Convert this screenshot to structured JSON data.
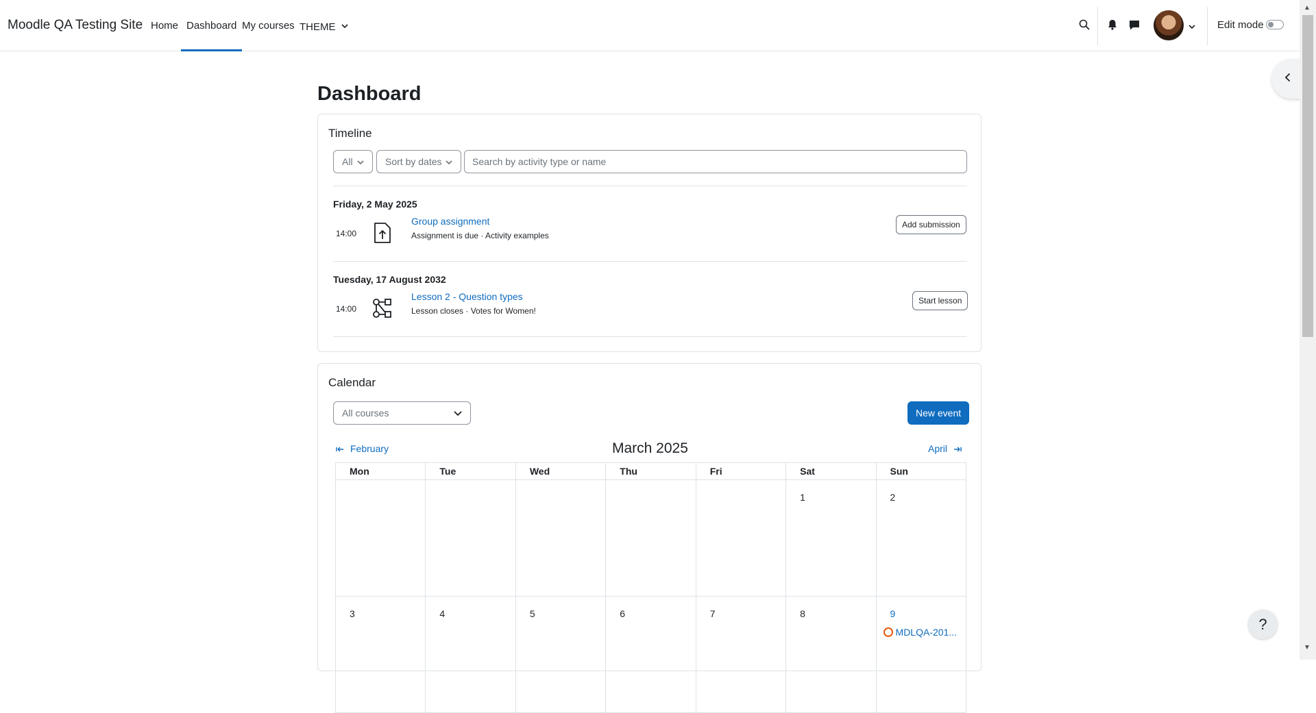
{
  "navbar": {
    "brand": "Moodle QA Testing Site",
    "items": [
      {
        "label": "Home"
      },
      {
        "label": "Dashboard"
      },
      {
        "label": "My courses"
      },
      {
        "label": "THEME"
      }
    ],
    "edit_mode_label": "Edit mode"
  },
  "page": {
    "title": "Dashboard"
  },
  "timeline": {
    "title": "Timeline",
    "filter_value": "All",
    "sort_value": "Sort by dates",
    "search_placeholder": "Search by activity type or name",
    "groups": [
      {
        "date": "Friday, 2 May 2025",
        "time": "14:00",
        "icon": "assignment-upload-icon",
        "name": "Group assignment",
        "subtitle": "Assignment is due · Activity examples",
        "action": "Add submission"
      },
      {
        "date": "Tuesday, 17 August 2032",
        "time": "14:00",
        "icon": "lesson-icon",
        "name": "Lesson 2 - Question types",
        "subtitle": "Lesson closes · Votes for Women!",
        "action": "Start lesson"
      }
    ]
  },
  "calendar": {
    "title": "Calendar",
    "course_filter": "All courses",
    "new_event_label": "New event",
    "prev_month": "February",
    "current_month": "March 2025",
    "next_month": "April",
    "weekdays": [
      "Mon",
      "Tue",
      "Wed",
      "Thu",
      "Fri",
      "Sat",
      "Sun"
    ],
    "weeks": [
      [
        "",
        "",
        "",
        "",
        "",
        "1",
        "2"
      ],
      [
        "3",
        "4",
        "5",
        "6",
        "7",
        "8",
        "9"
      ]
    ],
    "event_label": "MDLQA-201..."
  },
  "help": {
    "label": "?"
  },
  "colors": {
    "accent": "#0f6cbf",
    "event_dot": "#e8590c"
  }
}
